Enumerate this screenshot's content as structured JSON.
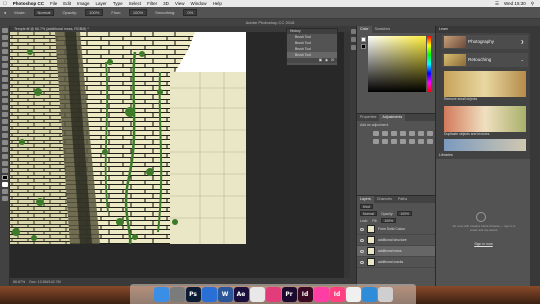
{
  "menubar": {
    "apple": "",
    "app_name": "Photoshop CC",
    "items": [
      "File",
      "Edit",
      "Image",
      "Layer",
      "Type",
      "Select",
      "Filter",
      "3D",
      "View",
      "Window",
      "Help"
    ],
    "clock": "Wed 15:30"
  },
  "options_bar": {
    "mode_label": "Mode:",
    "mode_value": "Normal",
    "opacity_label": "Opacity:",
    "opacity_value": "100%",
    "flow_label": "Flow:",
    "flow_value": "100%",
    "smoothing_label": "Smoothing:",
    "smoothing_value": "0%"
  },
  "window_title": "Adobe Photoshop CC 2018",
  "doc_tab": "Temple.tif @ 66.7% (additional moss, RGB/8) *",
  "history": {
    "title": "History",
    "items": [
      "Brush Tool",
      "Brush Tool",
      "Brush Tool",
      "Brush Tool"
    ],
    "selected_index": 3
  },
  "color_panel": {
    "tab_color": "Color",
    "tab_swatches": "Swatches",
    "accent": "#ffef3a"
  },
  "adjustments": {
    "tab_properties": "Properties",
    "tab_adjustments": "Adjustments",
    "prompt": "Add an adjustment"
  },
  "layers": {
    "tab_layers": "Layers",
    "tab_channels": "Channels",
    "tab_paths": "Paths",
    "kind": "Kind",
    "blend": "Normal",
    "opacity_label": "Opacity:",
    "opacity": "100%",
    "lock_label": "Lock:",
    "fill_label": "Fill:",
    "fill": "100%",
    "items": [
      {
        "name": "Form Solid Colour"
      },
      {
        "name": "additional structure"
      },
      {
        "name": "additional moss"
      },
      {
        "name": "additional cracks"
      }
    ],
    "selected_index": 2
  },
  "learn": {
    "title": "Learn",
    "topic1": "Photography",
    "topic2": "Retouching",
    "card1": "Remove small objects",
    "card2": "Duplicate objects and textures",
    "card3": ""
  },
  "libraries": {
    "title": "Libraries",
    "message": "Do more with Creative Cloud Libraries — sign in to create and use assets.",
    "link": "Sign in now"
  },
  "status": {
    "zoom": "66.67%",
    "doc": "Doc: 13.5M/142.7M"
  },
  "dock": {
    "apps": [
      {
        "label": "",
        "icon": "finder-icon",
        "color": "#3a8ee6"
      },
      {
        "label": "",
        "icon": "launchpad-icon",
        "color": "#7b7b7b"
      },
      {
        "label": "Ps",
        "icon": "photoshop-icon",
        "color": "#0b1b33"
      },
      {
        "label": "",
        "icon": "safari-icon",
        "color": "#2a6fd6"
      },
      {
        "label": "W",
        "icon": "word-icon",
        "color": "#2b579a"
      },
      {
        "label": "Ae",
        "icon": "aftereffects-icon",
        "color": "#1a0f3a"
      },
      {
        "label": "",
        "icon": "chrome-icon",
        "color": "#e8e8e8"
      },
      {
        "label": "",
        "icon": "itunes-icon",
        "color": "#e23c7a"
      },
      {
        "label": "Pr",
        "icon": "premiere-icon",
        "color": "#1c0a2e"
      },
      {
        "label": "Id",
        "icon": "indesign-icon",
        "color": "#3a0a22"
      },
      {
        "label": "",
        "icon": "xd-icon",
        "color": "#ff3ea5"
      },
      {
        "label": "Id",
        "icon": "indesign2-icon",
        "color": "#ff4081"
      },
      {
        "label": "",
        "icon": "photos-icon",
        "color": "#f0f0f0"
      },
      {
        "label": "",
        "icon": "sync-icon",
        "color": "#2f8cd8"
      },
      {
        "label": "",
        "icon": "trash-icon",
        "color": "#cfcfcf"
      }
    ]
  }
}
